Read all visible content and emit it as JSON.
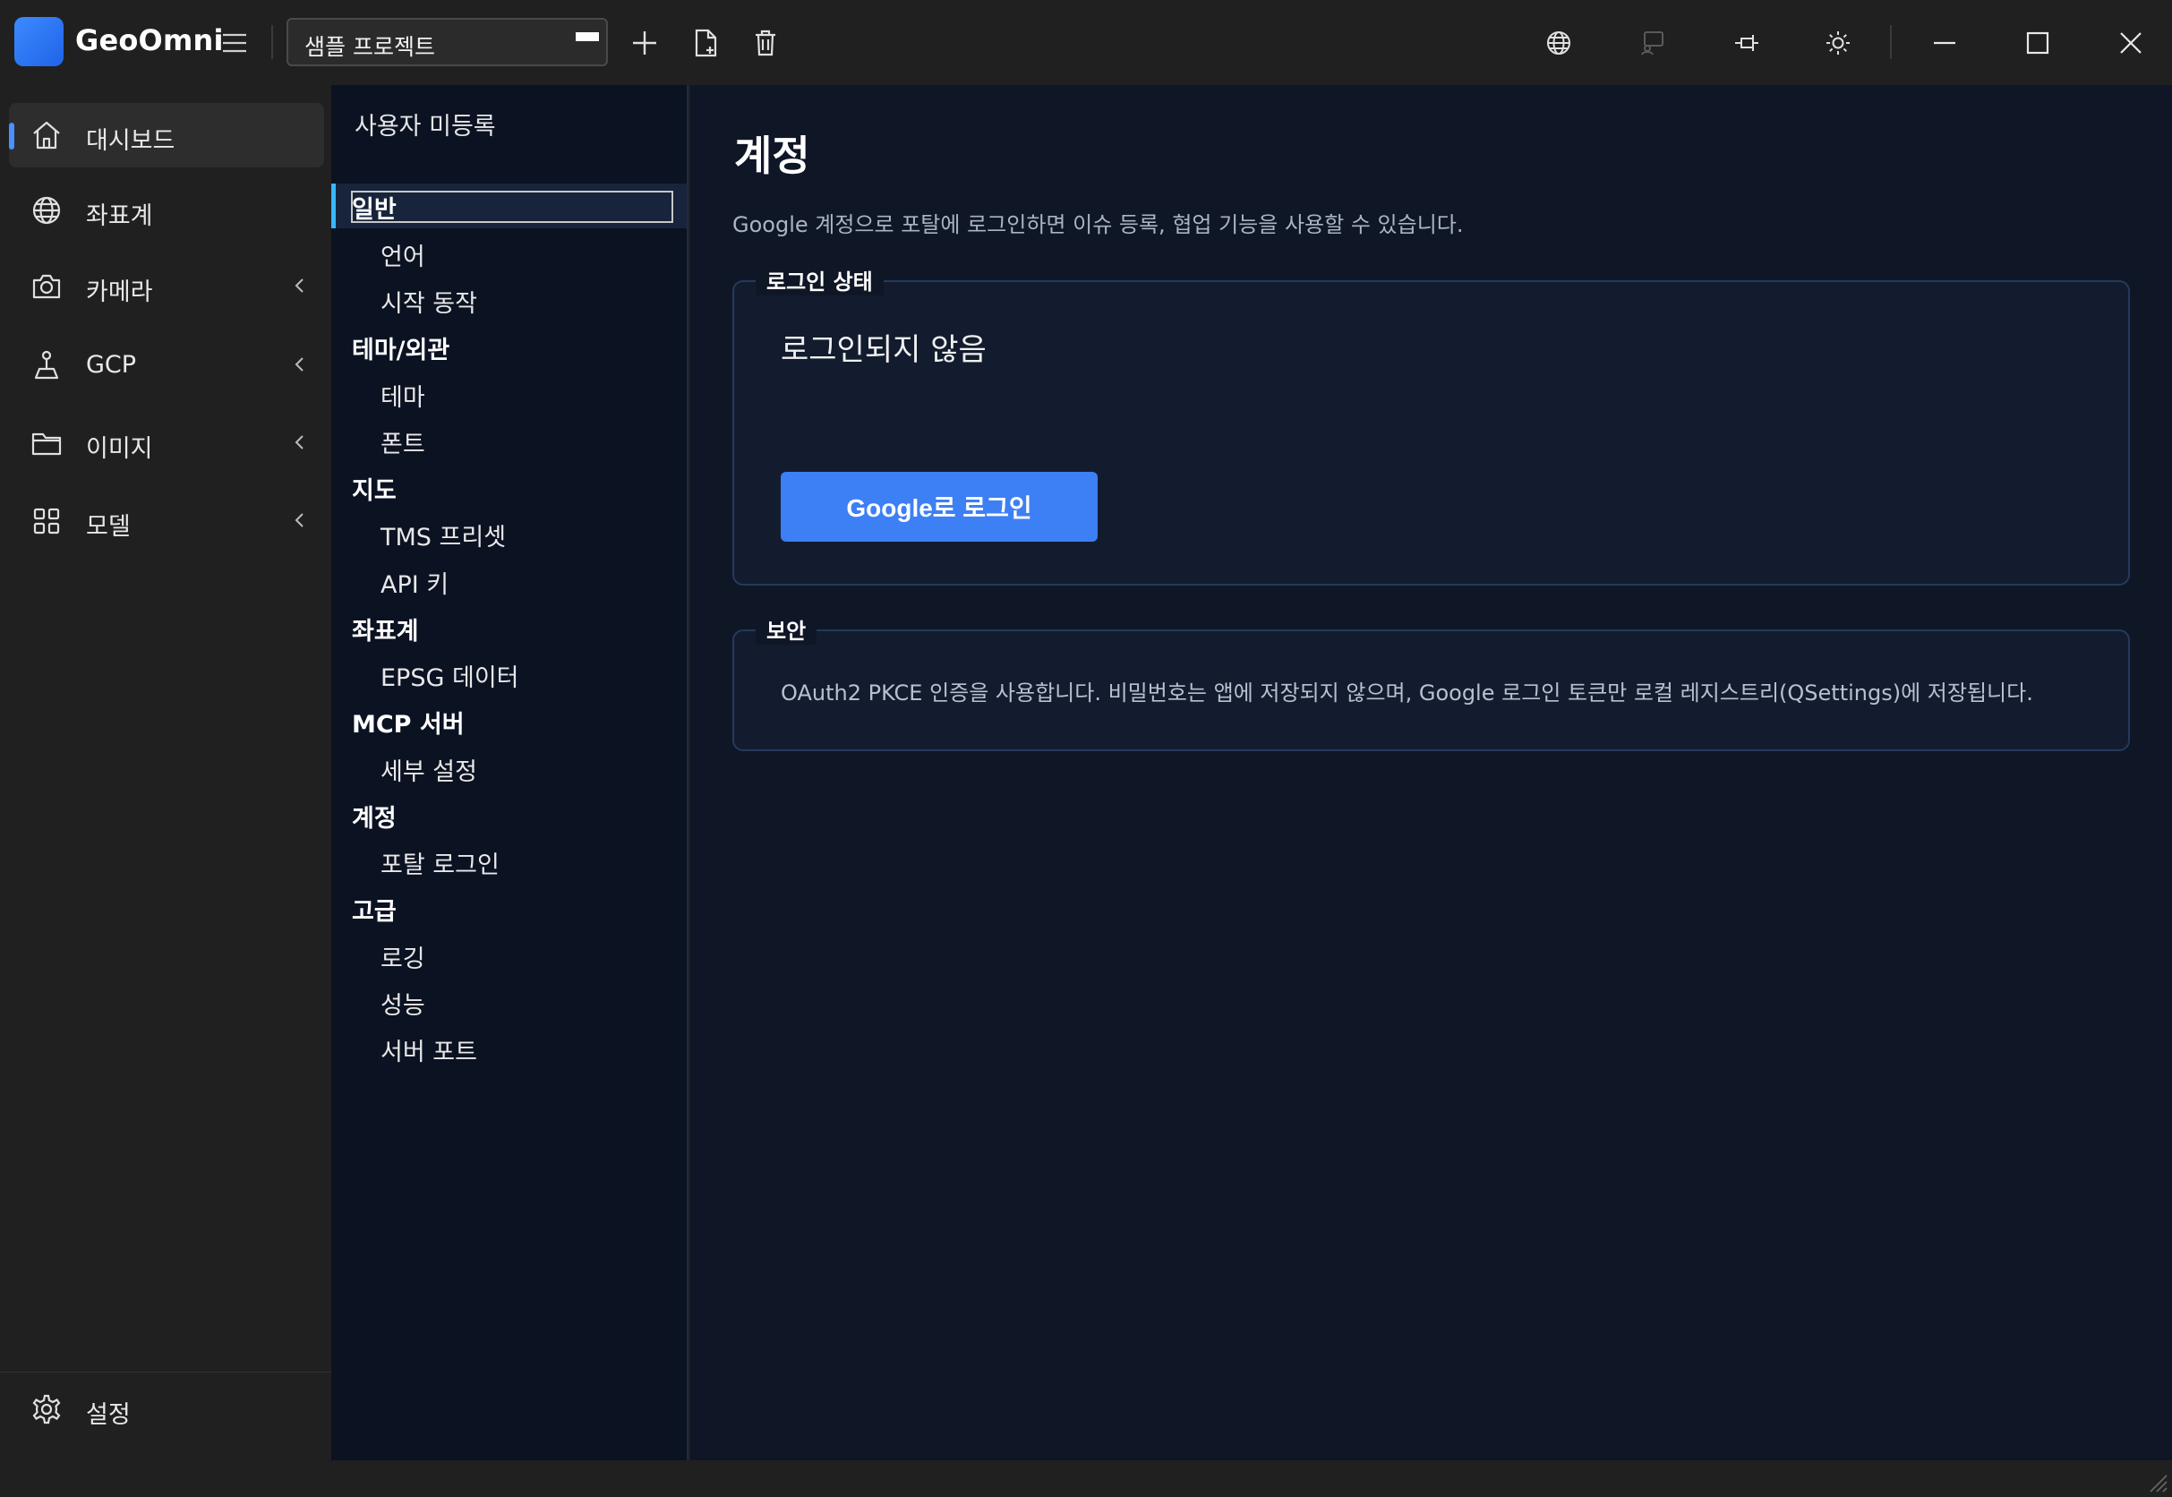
{
  "app": {
    "name": "GeoOmni"
  },
  "toolbar": {
    "project_value": "샘플 프로젝트",
    "icons": [
      "menu-icon",
      "add-icon",
      "new-file-icon",
      "trash-icon",
      "globe-icon",
      "present-icon",
      "pin-icon",
      "sun-icon"
    ],
    "window_controls": [
      "minimize-icon",
      "maximize-icon",
      "close-icon"
    ]
  },
  "leftnav": {
    "items": [
      {
        "label": "대시보드",
        "icon": "home-icon",
        "active": true
      },
      {
        "label": "좌표계",
        "icon": "globe-icon"
      },
      {
        "label": "카메라",
        "icon": "camera-icon",
        "expandable": true
      },
      {
        "label": "GCP",
        "icon": "survey-icon",
        "expandable": true
      },
      {
        "label": "이미지",
        "icon": "folder-icon",
        "expandable": true
      },
      {
        "label": "모델",
        "icon": "grid-icon",
        "expandable": true
      }
    ],
    "settings_label": "설정"
  },
  "tree": {
    "title": "사용자 미등록",
    "nodes": [
      {
        "label": "일반",
        "level": 0,
        "selected": true
      },
      {
        "label": "언어",
        "level": 1
      },
      {
        "label": "시작 동작",
        "level": 1
      },
      {
        "label": "테마/외관",
        "level": 0
      },
      {
        "label": "테마",
        "level": 1
      },
      {
        "label": "폰트",
        "level": 1
      },
      {
        "label": "지도",
        "level": 0
      },
      {
        "label": "TMS 프리셋",
        "level": 1
      },
      {
        "label": "API 키",
        "level": 1
      },
      {
        "label": "좌표계",
        "level": 0
      },
      {
        "label": "EPSG 데이터",
        "level": 1
      },
      {
        "label": "MCP 서버",
        "level": 0
      },
      {
        "label": "세부 설정",
        "level": 1
      },
      {
        "label": "계정",
        "level": 0
      },
      {
        "label": "포탈 로그인",
        "level": 1
      },
      {
        "label": "고급",
        "level": 0
      },
      {
        "label": "로깅",
        "level": 1
      },
      {
        "label": "성능",
        "level": 1
      },
      {
        "label": "서버 포트",
        "level": 1
      }
    ]
  },
  "content": {
    "title": "계정",
    "description": "Google 계정으로 포탈에 로그인하면 이슈 등록, 협업 기능을 사용할 수 있습니다.",
    "login_group": {
      "title": "로그인 상태",
      "status": "로그인되지 않음",
      "button_label": "Google로 로그인"
    },
    "security_group": {
      "title": "보안",
      "text": "OAuth2 PKCE 인증을 사용합니다. 비밀번호는 앱에 저장되지 않으며, Google 로그인 토큰만 로컬 레지스트리(QSettings)에 저장됩니다."
    }
  },
  "colors": {
    "accent": "#3d7ff5",
    "nav_indicator": "#4a90ff",
    "tree_selection": "#36b8ff",
    "content_bg": "#0f1626",
    "chrome_bg": "#202020"
  }
}
